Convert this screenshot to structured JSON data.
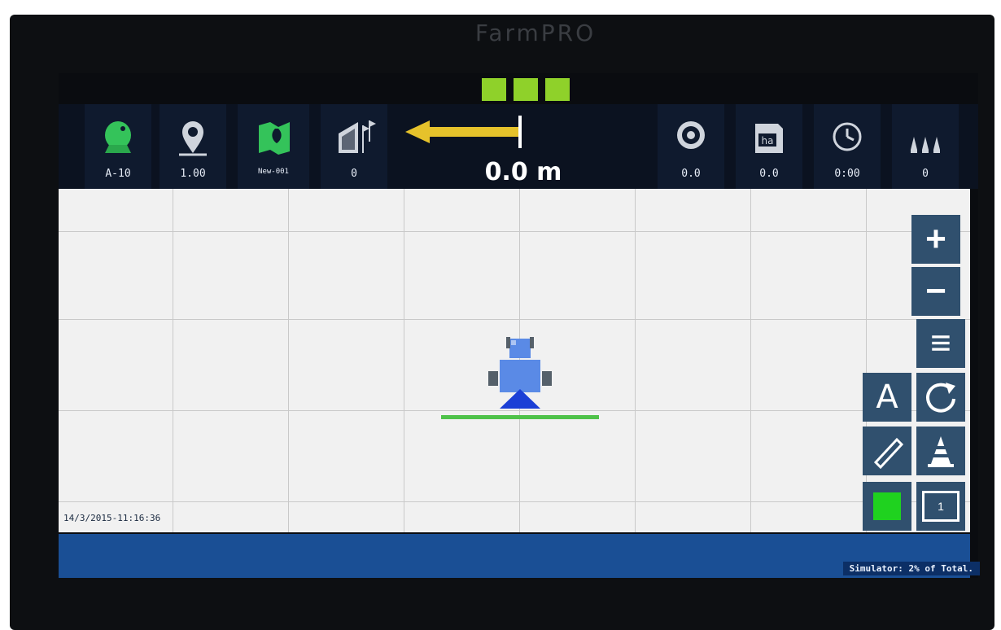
{
  "brand": "FarmPRO",
  "status_leds": 3,
  "toolbar": {
    "tiles": [
      {
        "value": "A-10",
        "icon": "satellite-dish-icon"
      },
      {
        "value": "1.00",
        "icon": "location-pin-icon"
      },
      {
        "value": "New-001",
        "icon": "field-map-icon"
      },
      {
        "value": "0",
        "icon": "field-flags-icon"
      }
    ],
    "guidance": {
      "distance": "0.0 m",
      "direction": "left",
      "arrow_color": "#e6c22b"
    },
    "right_tiles": [
      {
        "value": "0.0",
        "icon": "speedometer-icon"
      },
      {
        "value": "0.0",
        "icon": "hectare-icon"
      },
      {
        "value": "0:00",
        "icon": "clock-icon"
      },
      {
        "value": "0",
        "icon": "sections-icon"
      }
    ]
  },
  "map": {
    "timestamp": "14/3/2015-11:16:36",
    "vehicle_color": "#5a8ae6",
    "boom_color": "#4fc24a"
  },
  "controls": {
    "zoom_in": "+",
    "zoom_out": "−",
    "menu": "≡",
    "auto_label": "A",
    "screen_number": "1"
  },
  "status": {
    "text": "Simulator: 2% of Total."
  },
  "colors": {
    "accent": "#8fd12a",
    "panel": "#0f1a2e",
    "statusbar": "#1a4f95"
  }
}
